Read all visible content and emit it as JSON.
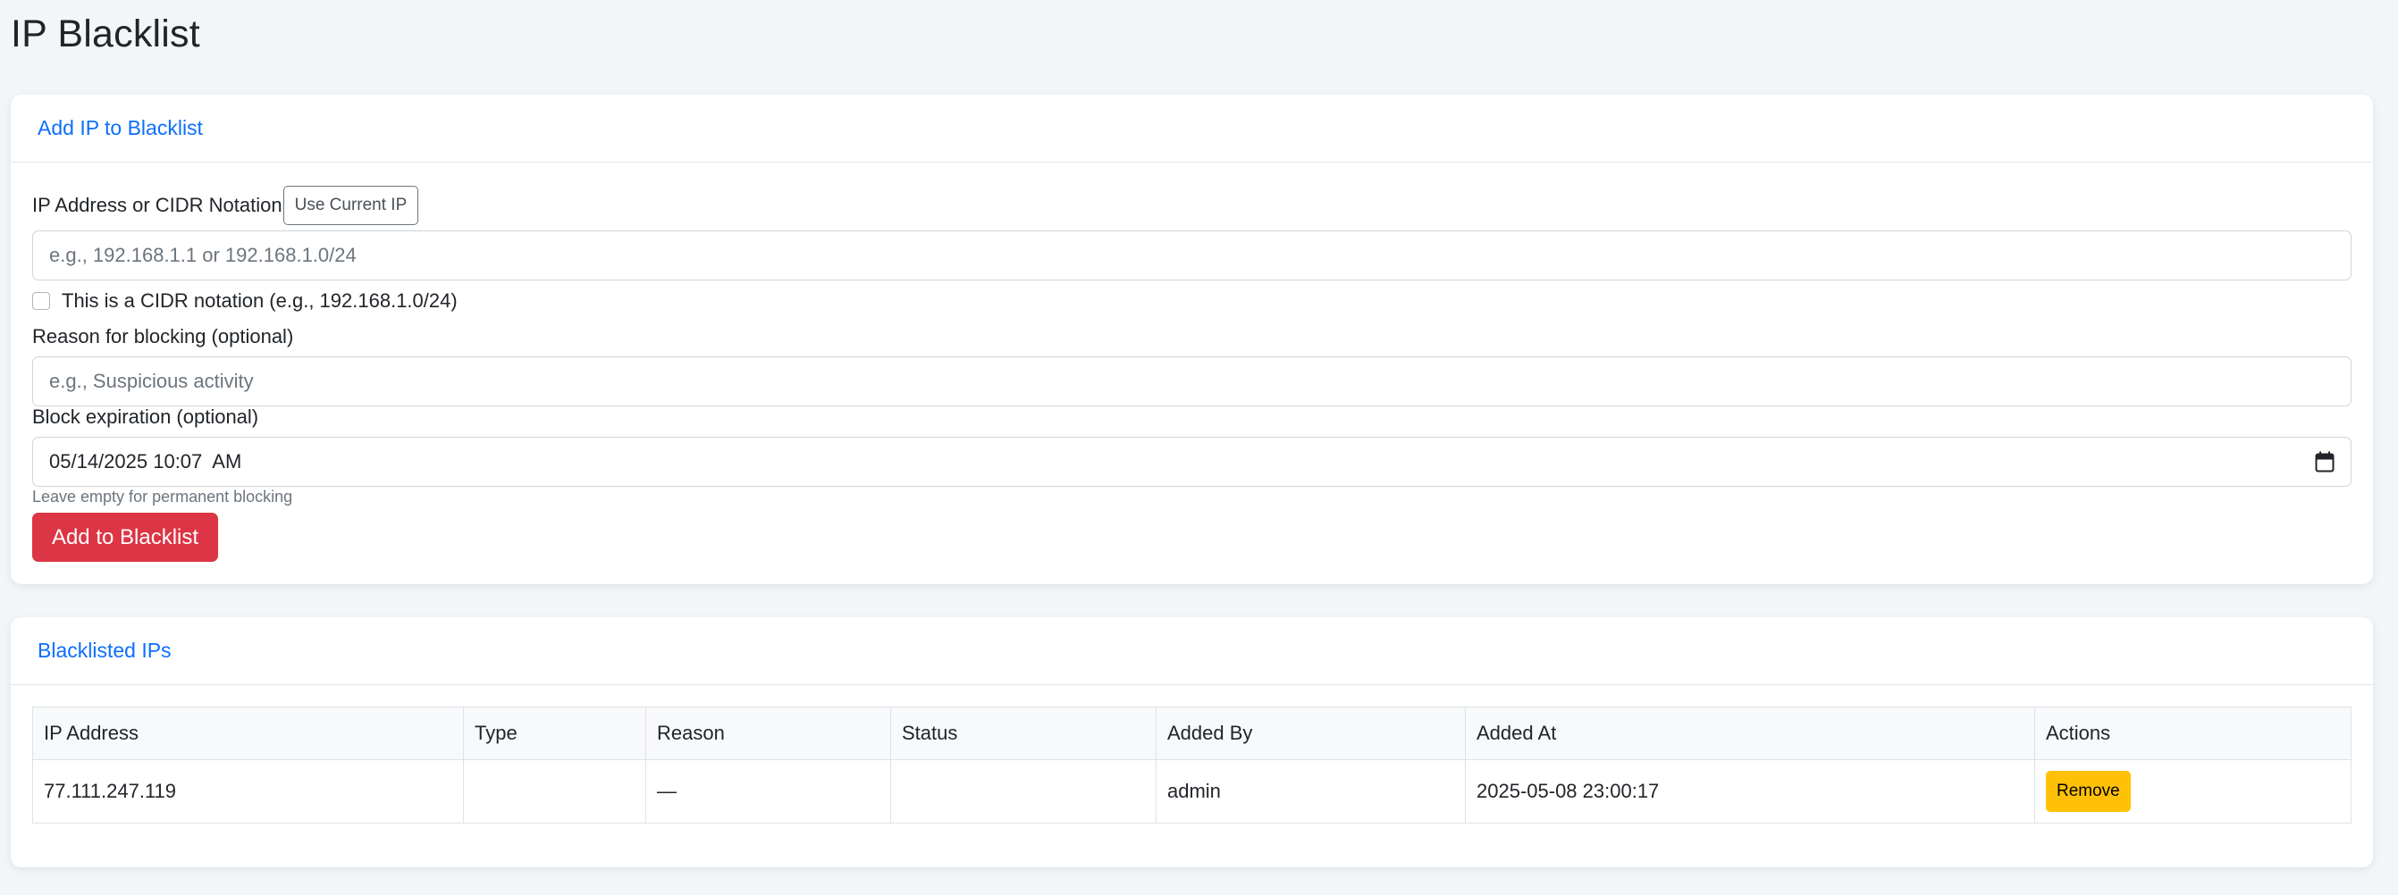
{
  "page": {
    "title": "IP Blacklist"
  },
  "add_form": {
    "header": "Add IP to Blacklist",
    "ip_label": "IP Address or CIDR Notation",
    "use_current_ip_label": "Use Current IP",
    "ip_placeholder": "e.g., 192.168.1.1 or 192.168.1.0/24",
    "cidr_checkbox_label": "This is a CIDR notation (e.g., 192.168.1.0/24)",
    "cidr_checked": false,
    "reason_label": "Reason for blocking (optional)",
    "reason_placeholder": "e.g., Suspicious activity",
    "expiration_label": "Block expiration (optional)",
    "expiration_value": "05/14/2025 10:07  AM",
    "expiration_help": "Leave empty for permanent blocking",
    "submit_label": "Add to Blacklist"
  },
  "blacklist": {
    "header": "Blacklisted IPs",
    "columns": [
      "IP Address",
      "Type",
      "Reason",
      "Status",
      "Added By",
      "Added At",
      "Actions"
    ],
    "rows": [
      {
        "ip": "77.111.247.119",
        "type": "",
        "reason": "—",
        "status": "",
        "added_by": "admin",
        "added_at": "2025-05-08 23:00:17",
        "action_label": "Remove"
      }
    ]
  },
  "colors": {
    "accent": "#0d6efd",
    "danger": "#dc3545",
    "warning": "#ffc107",
    "background": "#f3f6f9"
  },
  "icons": {
    "expiration_picker": "calendar-icon"
  }
}
